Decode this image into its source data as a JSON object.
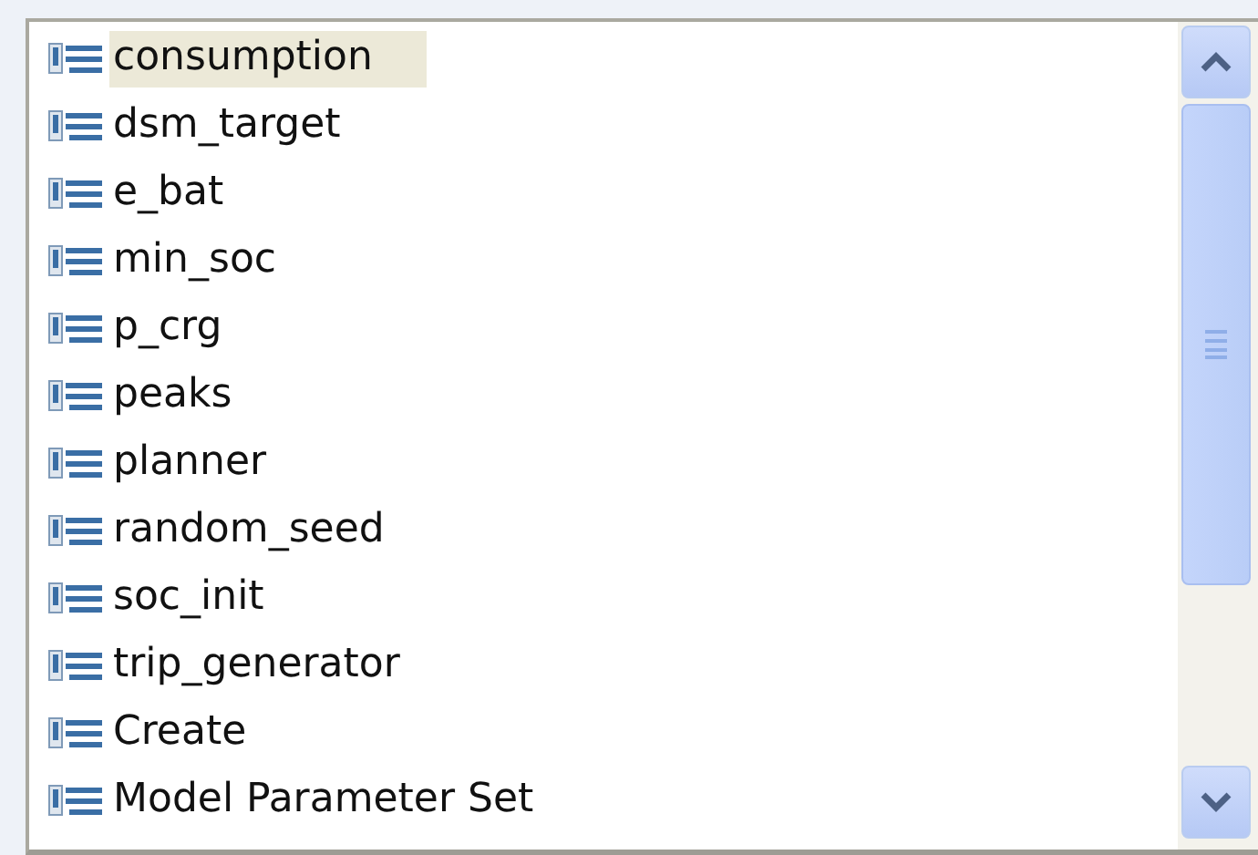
{
  "list": {
    "items": [
      {
        "label": "consumption",
        "selected": true
      },
      {
        "label": "dsm_target",
        "selected": false
      },
      {
        "label": "e_bat",
        "selected": false
      },
      {
        "label": "min_soc",
        "selected": false
      },
      {
        "label": "p_crg",
        "selected": false
      },
      {
        "label": "peaks",
        "selected": false
      },
      {
        "label": "planner",
        "selected": false
      },
      {
        "label": "random_seed",
        "selected": false
      },
      {
        "label": "soc_init",
        "selected": false
      },
      {
        "label": "trip_generator",
        "selected": false
      },
      {
        "label": "Create",
        "selected": false
      },
      {
        "label": "Model Parameter Set",
        "selected": false
      }
    ]
  }
}
